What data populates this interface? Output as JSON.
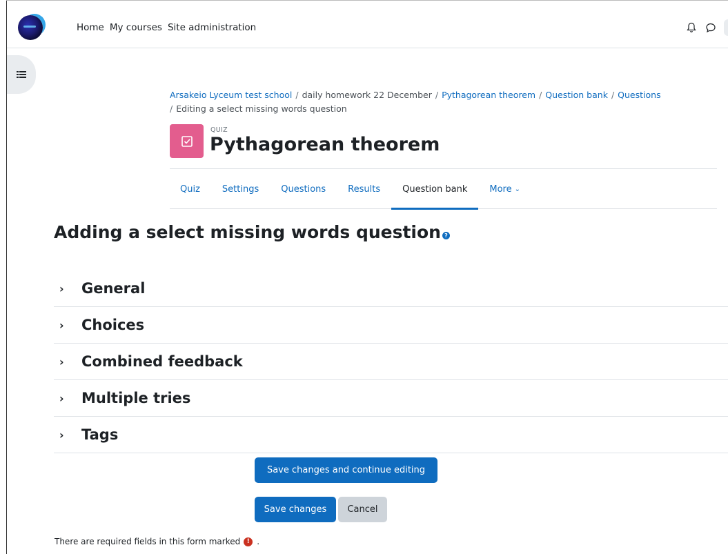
{
  "navbar": {
    "links": [
      "Home",
      "My courses",
      "Site administration"
    ],
    "icons": [
      "bell-icon",
      "chat-icon"
    ]
  },
  "breadcrumb": [
    {
      "label": "Arsakeio Lyceum test school",
      "link": true
    },
    {
      "label": "daily homework 22 December",
      "link": false
    },
    {
      "label": "Pythagorean theorem",
      "link": true
    },
    {
      "label": "Question bank",
      "link": true
    },
    {
      "label": "Questions",
      "link": true
    },
    {
      "label": "Editing a select missing words question",
      "link": false
    }
  ],
  "activity": {
    "type": "QUIZ",
    "title": "Pythagorean theorem",
    "icon_color": "#e35d8e"
  },
  "secondary_nav": {
    "tabs": [
      "Quiz",
      "Settings",
      "Questions",
      "Results",
      "Question bank",
      "More"
    ],
    "active": "Question bank"
  },
  "main": {
    "heading": "Adding a select missing words question",
    "sections": [
      "General",
      "Choices",
      "Combined feedback",
      "Multiple tries",
      "Tags"
    ]
  },
  "buttons": {
    "save_continue": "Save changes and continue editing",
    "save": "Save changes",
    "cancel": "Cancel"
  },
  "footer": {
    "required_note": "There are required fields in this form marked",
    "required_suffix": "."
  },
  "colors": {
    "primary": "#0f6cbf",
    "required": "#ca3120"
  }
}
